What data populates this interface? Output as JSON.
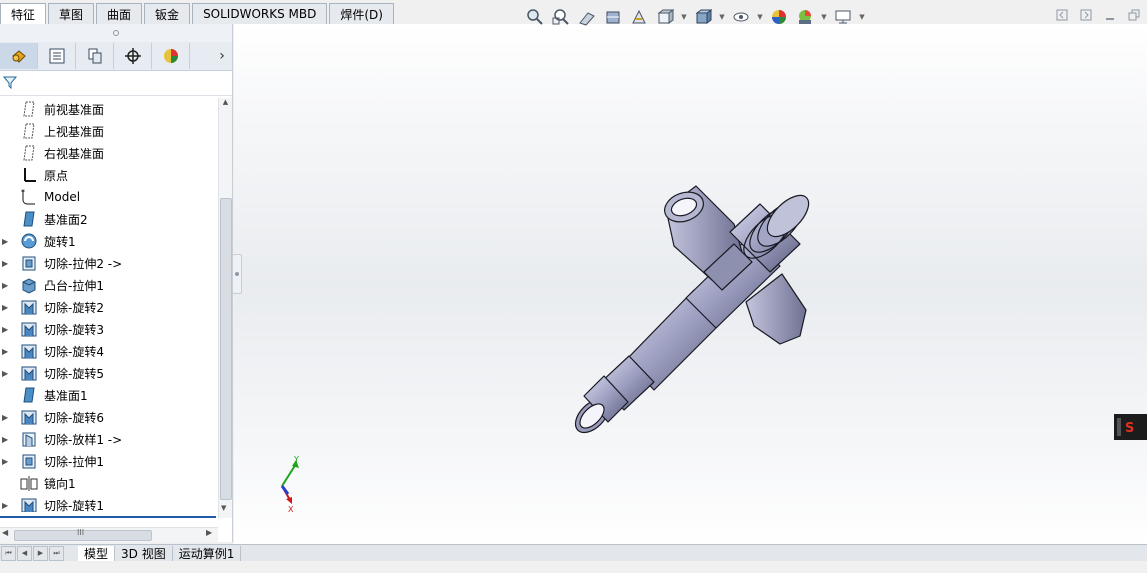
{
  "command_tabs": [
    "特征",
    "草图",
    "曲面",
    "钣金",
    "SOLIDWORKS MBD",
    "焊件(D)"
  ],
  "view_toolbar": {
    "icons": [
      "zoom-to-fit-icon",
      "zoom-to-area-icon",
      "previous-view-icon",
      "section-view-icon",
      "dynamic-annotation-icon",
      "view-orientation-icon",
      "display-style-icon",
      "hide-show-items-icon",
      "edit-appearance-icon",
      "apply-scene-icon",
      "view-settings-icon"
    ]
  },
  "feature_manager": {
    "tab_icons": [
      "feature-manager-icon",
      "property-manager-icon",
      "configuration-manager-icon",
      "dimxpert-manager-icon",
      "display-manager-icon"
    ],
    "tree": [
      {
        "label": "前视基准面",
        "icon": "plane",
        "expandable": false
      },
      {
        "label": "上视基准面",
        "icon": "plane",
        "expandable": false
      },
      {
        "label": "右视基准面",
        "icon": "plane",
        "expandable": false
      },
      {
        "label": "原点",
        "icon": "origin",
        "expandable": false
      },
      {
        "label": "Model",
        "icon": "sketch",
        "expandable": false
      },
      {
        "label": "基准面2",
        "icon": "plane-solid",
        "expandable": false
      },
      {
        "label": "旋转1",
        "icon": "revolve",
        "expandable": true
      },
      {
        "label": "切除-拉伸2 ->",
        "icon": "cut-extrude",
        "expandable": true
      },
      {
        "label": "凸台-拉伸1",
        "icon": "boss-extrude",
        "expandable": true
      },
      {
        "label": "切除-旋转2",
        "icon": "cut-revolve",
        "expandable": true
      },
      {
        "label": "切除-旋转3",
        "icon": "cut-revolve",
        "expandable": true
      },
      {
        "label": "切除-旋转4",
        "icon": "cut-revolve",
        "expandable": true
      },
      {
        "label": "切除-旋转5",
        "icon": "cut-revolve",
        "expandable": true
      },
      {
        "label": "基准面1",
        "icon": "plane-solid",
        "expandable": false
      },
      {
        "label": "切除-旋转6",
        "icon": "cut-revolve",
        "expandable": true
      },
      {
        "label": "切除-放样1 ->",
        "icon": "cut-loft",
        "expandable": true
      },
      {
        "label": "切除-拉伸1",
        "icon": "cut-extrude",
        "expandable": true
      },
      {
        "label": "镜向1",
        "icon": "mirror",
        "expandable": false
      },
      {
        "label": "切除-旋转1",
        "icon": "cut-revolve",
        "expandable": true
      }
    ]
  },
  "bottom_tabs": [
    "模型",
    "3D 视图",
    "运动算例1"
  ],
  "scroll_glyph": "III",
  "triad": {
    "y_label": "Y",
    "x_label": "X"
  },
  "colors": {
    "accent": "#1e5aa8",
    "part": "#a7a9c7",
    "triad_y": "#1aa51a",
    "triad_x": "#d01818",
    "triad_z": "#2a3fc8"
  }
}
